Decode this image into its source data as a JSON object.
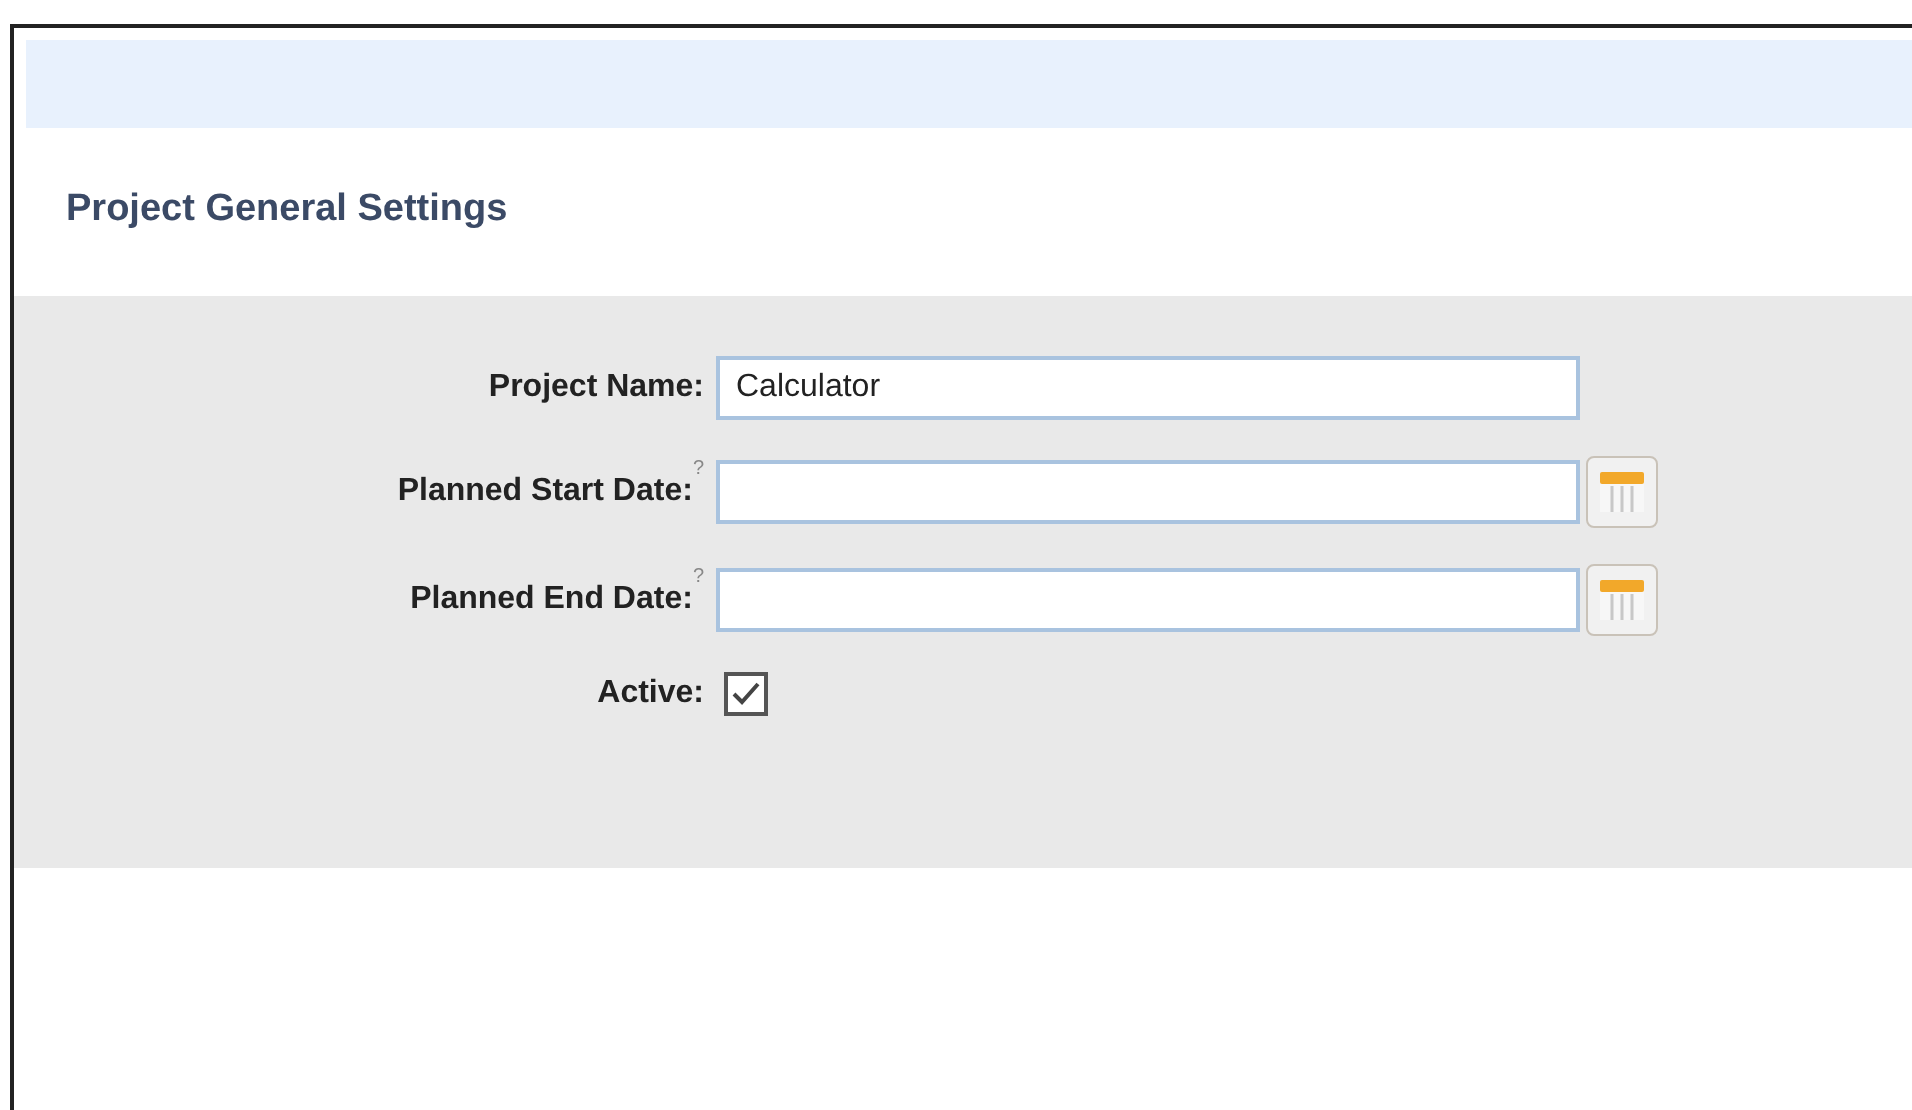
{
  "section_title": "Project General Settings",
  "fields": [
    {
      "kind": "text",
      "label": "Project Name:",
      "value": "Calculator"
    },
    {
      "kind": "date",
      "label": "Planned Start Date:",
      "help": "?"
    },
    {
      "kind": "date",
      "label": "Planned End Date:",
      "help": "?"
    },
    {
      "kind": "checkbox",
      "label": "Active:",
      "checked": true
    }
  ]
}
